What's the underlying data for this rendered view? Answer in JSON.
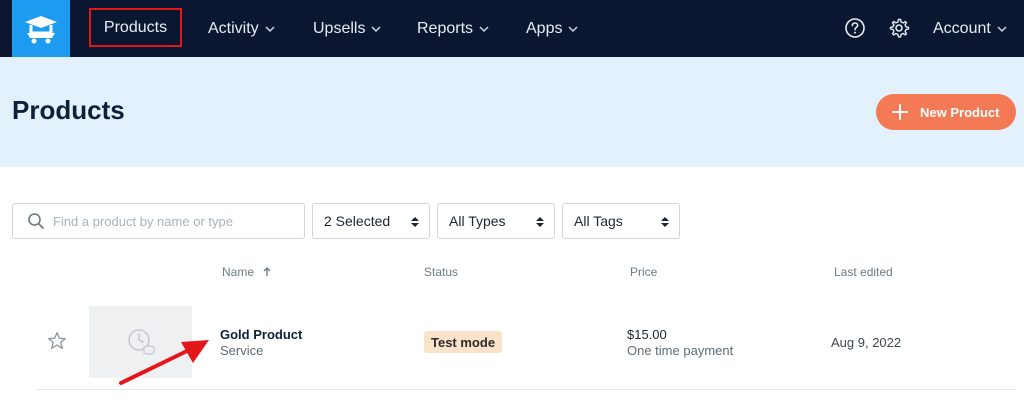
{
  "nav": {
    "items": [
      {
        "label": "Products"
      },
      {
        "label": "Activity"
      },
      {
        "label": "Upsells"
      },
      {
        "label": "Reports"
      },
      {
        "label": "Apps"
      }
    ],
    "account_label": "Account",
    "icons": [
      "logo-icon",
      "help-icon",
      "gear-icon",
      "chevron-down-icon"
    ]
  },
  "header": {
    "title": "Products",
    "new_product_label": "New Product"
  },
  "filters": {
    "search_placeholder": "Find a product by name or type",
    "selects": [
      {
        "value": "2 Selected"
      },
      {
        "value": "All Types"
      },
      {
        "value": "All Tags"
      }
    ]
  },
  "table": {
    "columns": {
      "name": "Name",
      "status": "Status",
      "price": "Price",
      "edited": "Last edited"
    },
    "rows": [
      {
        "name": "Gold Product",
        "type": "Service",
        "status": "Test mode",
        "price": "$15.00",
        "price_note": "One time payment",
        "edited": "Aug 9, 2022"
      }
    ]
  },
  "colors": {
    "nav_bg": "#0b1730",
    "logo_bg": "#1d9bf0",
    "header_bg": "#e2f1fb",
    "accent": "#f47a55",
    "highlight": "#e3161c",
    "badge_bg": "#fbe3c9"
  }
}
